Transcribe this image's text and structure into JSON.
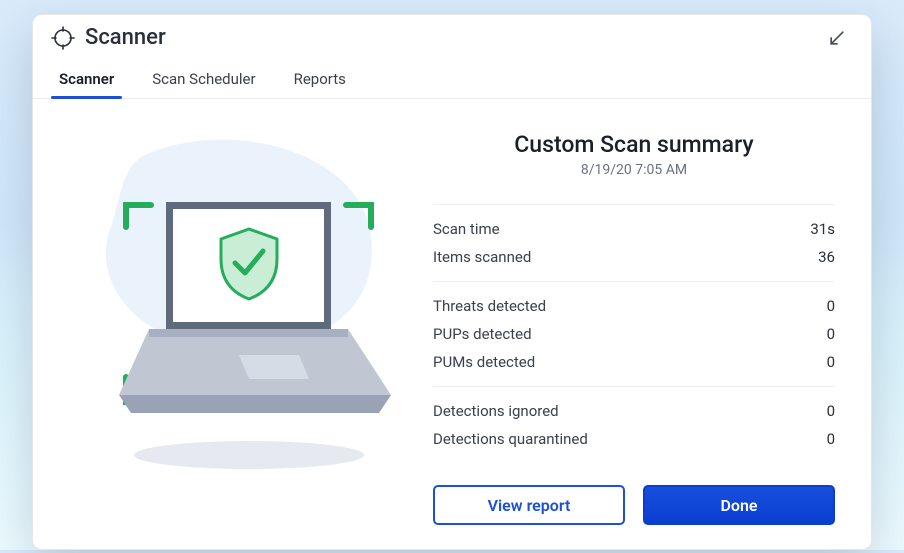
{
  "header": {
    "title": "Scanner"
  },
  "tabs": {
    "items": [
      "Scanner",
      "Scan Scheduler",
      "Reports"
    ],
    "active_index": 0
  },
  "summary": {
    "title": "Custom Scan summary",
    "timestamp": "8/19/20 7:05 AM",
    "groups": [
      [
        {
          "label": "Scan time",
          "value": "31s"
        },
        {
          "label": "Items scanned",
          "value": "36"
        }
      ],
      [
        {
          "label": "Threats detected",
          "value": "0"
        },
        {
          "label": "PUPs detected",
          "value": "0"
        },
        {
          "label": "PUMs detected",
          "value": "0"
        }
      ],
      [
        {
          "label": "Detections ignored",
          "value": "0"
        },
        {
          "label": "Detections quarantined",
          "value": "0"
        }
      ]
    ]
  },
  "actions": {
    "view_report": "View report",
    "done": "Done"
  },
  "icons": {
    "scanner": "crosshair-icon",
    "collapse": "collapse-icon",
    "laptop_status": "shield-check-icon"
  },
  "colors": {
    "accent": "#1d4fd7",
    "success": "#25ad5c"
  }
}
